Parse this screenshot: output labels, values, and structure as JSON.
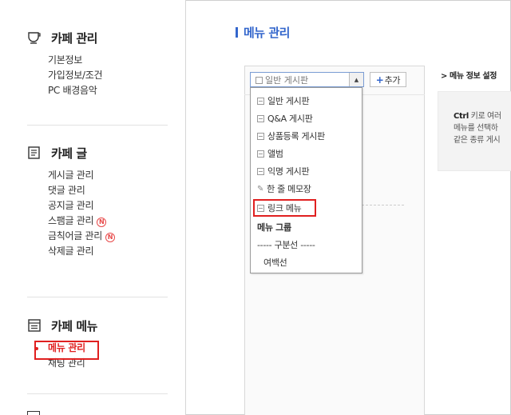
{
  "sidebar": {
    "sections": [
      {
        "title": "카페 관리",
        "icon": "cup-icon",
        "items": [
          "기본정보",
          "가입정보/조건",
          "PC 배경음악"
        ]
      },
      {
        "title": "카페 글",
        "icon": "document-icon",
        "items": [
          "게시글 관리",
          "댓글 관리",
          "공지글 관리",
          "스팸글 관리",
          "금칙어글 관리",
          "삭제글 관리"
        ]
      },
      {
        "title": "카페 메뉴",
        "icon": "menu-list-icon",
        "items": [
          "메뉴 관리",
          "채팅 관리"
        ]
      }
    ],
    "new_badge": "N",
    "active_item": "메뉴 관리"
  },
  "main": {
    "title": "메뉴 관리",
    "select_value": "일반 게시판",
    "add_label": "추가",
    "add_plus": "+",
    "dropdown": [
      {
        "label": "일반 게시판",
        "icon": "board-icon"
      },
      {
        "label": "Q&A 게시판",
        "icon": "qa-icon"
      },
      {
        "label": "상품등록 게시판",
        "icon": "product-icon"
      },
      {
        "label": "앨범",
        "icon": "album-icon"
      },
      {
        "label": "익명 게시판",
        "icon": "anonymous-board-icon"
      },
      {
        "label": "한 줄 메모장",
        "icon": "pencil-icon"
      },
      {
        "label": "링크 메뉴",
        "icon": "link-icon"
      },
      {
        "label": "메뉴 그룹"
      },
      {
        "label": "----- 구분선 -----"
      },
      {
        "label": "여백선"
      }
    ],
    "settings": {
      "title": "> 메뉴 정보 설정",
      "line1_key": "Ctrl",
      "line1_rest": " 키로 여러",
      "line2": "메뉴를 선택하",
      "line3": "같은 종류 게시"
    }
  },
  "colors": {
    "accent": "#3366cc",
    "highlight": "#e02020"
  }
}
